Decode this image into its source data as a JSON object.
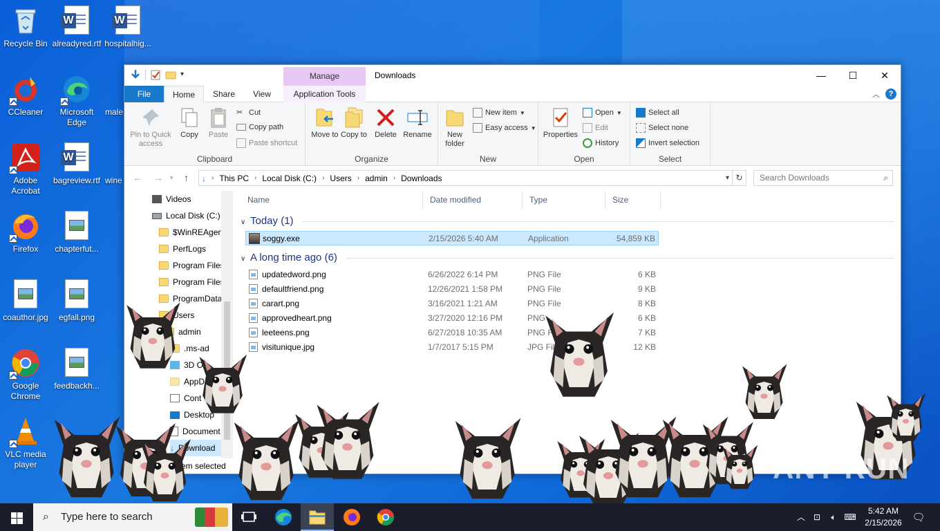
{
  "desktop": {
    "icons": [
      {
        "label": "Recycle Bin"
      },
      {
        "label": "alreadyred.rtf"
      },
      {
        "label": "hospitalhig..."
      },
      {
        "label": "CCleaner"
      },
      {
        "label": "Microsoft Edge"
      },
      {
        "label": "male"
      },
      {
        "label": "Adobe Acrobat"
      },
      {
        "label": "bagreview.rtf"
      },
      {
        "label": "wine"
      },
      {
        "label": "Firefox"
      },
      {
        "label": "chapterfut..."
      },
      {
        "label": "coauthor.jpg"
      },
      {
        "label": "egfall.png"
      },
      {
        "label": "Google Chrome"
      },
      {
        "label": "feedbackh..."
      },
      {
        "label": "VLC media player"
      }
    ]
  },
  "window": {
    "title": "Downloads",
    "manage_tab": "Manage",
    "tabs": {
      "file": "File",
      "home": "Home",
      "share": "Share",
      "view": "View",
      "app_tools": "Application Tools"
    },
    "controls": {
      "minimize": "—",
      "maximize": "☐",
      "close": "✕"
    },
    "ribbon": {
      "clipboard": {
        "label": "Clipboard",
        "pin": "Pin to Quick access",
        "copy": "Copy",
        "paste": "Paste",
        "cut": "Cut",
        "copy_path": "Copy path",
        "paste_shortcut": "Paste shortcut"
      },
      "organize": {
        "label": "Organize",
        "move_to": "Move to",
        "copy_to": "Copy to",
        "delete": "Delete",
        "rename": "Rename"
      },
      "new": {
        "label": "New",
        "new_folder": "New folder",
        "new_item": "New item",
        "easy_access": "Easy access"
      },
      "open": {
        "label": "Open",
        "properties": "Properties",
        "open": "Open",
        "edit": "Edit",
        "history": "History"
      },
      "select": {
        "label": "Select",
        "select_all": "Select all",
        "select_none": "Select none",
        "invert": "Invert selection"
      }
    },
    "address": {
      "crumbs": [
        "This PC",
        "Local Disk (C:)",
        "Users",
        "admin",
        "Downloads"
      ],
      "search_placeholder": "Search Downloads"
    },
    "nav": {
      "items": [
        {
          "label": "Videos"
        },
        {
          "label": "Local Disk (C:)"
        },
        {
          "label": "$WinREAgent"
        },
        {
          "label": "PerfLogs"
        },
        {
          "label": "Program Files"
        },
        {
          "label": "Program Files"
        },
        {
          "label": "ProgramData"
        },
        {
          "label": "Users"
        },
        {
          "label": "admin"
        },
        {
          "label": ".ms-ad"
        },
        {
          "label": "3D Ob"
        },
        {
          "label": "AppDa"
        },
        {
          "label": "Cont"
        },
        {
          "label": "Desktop"
        },
        {
          "label": "Document"
        },
        {
          "label": "Download"
        }
      ]
    },
    "columns": {
      "name": "Name",
      "date": "Date modified",
      "type": "Type",
      "size": "Size"
    },
    "groups": [
      {
        "title": "Today (1)",
        "files": [
          {
            "name": "soggy.exe",
            "date": "2/15/2026 5:40 AM",
            "type": "Application",
            "size": "54,859 KB"
          }
        ]
      },
      {
        "title": "A long time ago (6)",
        "files": [
          {
            "name": "updatedword.png",
            "date": "6/26/2022 6:14 PM",
            "type": "PNG File",
            "size": "6 KB"
          },
          {
            "name": "defaultfriend.png",
            "date": "12/26/2021 1:58 PM",
            "type": "PNG File",
            "size": "9 KB"
          },
          {
            "name": "carart.png",
            "date": "3/16/2021 1:21 AM",
            "type": "PNG File",
            "size": "8 KB"
          },
          {
            "name": "approvedheart.png",
            "date": "3/27/2020 12:16 PM",
            "type": "PNG",
            "size": "6 KB"
          },
          {
            "name": "leeteens.png",
            "date": "6/27/2018 10:35 AM",
            "type": "PNG F",
            "size": "7 KB"
          },
          {
            "name": "visitunique.jpg",
            "date": "1/7/2017 5:15 PM",
            "type": "JPG File",
            "size": "12 KB"
          }
        ]
      }
    ],
    "status": "item selected"
  },
  "taskbar": {
    "search_placeholder": "Type here to search",
    "time": "5:42 AM",
    "date": "2/15/2026"
  },
  "watermark": "ANY RUN"
}
